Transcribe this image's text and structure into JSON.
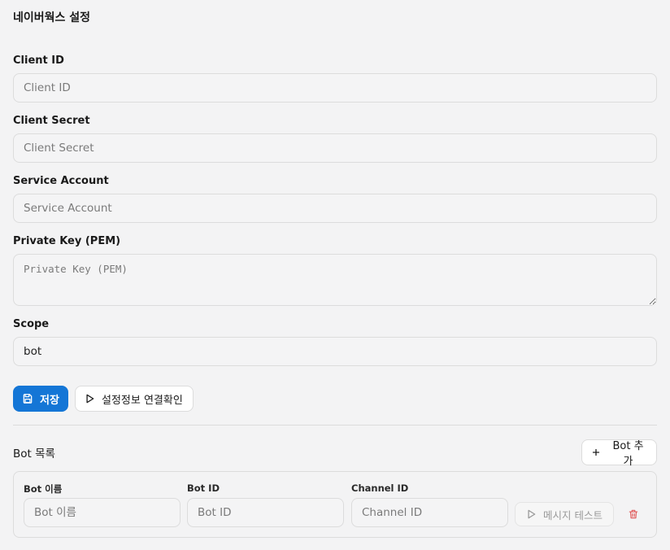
{
  "page": {
    "title": "네이버웍스 설정"
  },
  "form": {
    "client_id": {
      "label": "Client ID",
      "placeholder": "Client ID",
      "value": ""
    },
    "client_secret": {
      "label": "Client Secret",
      "placeholder": "Client Secret",
      "value": ""
    },
    "service_account": {
      "label": "Service Account",
      "placeholder": "Service Account",
      "value": ""
    },
    "private_key": {
      "label": "Private Key (PEM)",
      "placeholder": "Private Key (PEM)",
      "value": ""
    },
    "scope": {
      "label": "Scope",
      "placeholder": "",
      "value": "bot"
    }
  },
  "actions": {
    "save_label": "저장",
    "test_connection_label": "설정정보 연결확인"
  },
  "bots": {
    "section_title": "Bot 목록",
    "add_label": "Bot 추가",
    "columns": {
      "name": "Bot 이름",
      "id": "Bot ID",
      "channel": "Channel ID"
    },
    "rows": [
      {
        "name_placeholder": "Bot 이름",
        "id_placeholder": "Bot ID",
        "channel_placeholder": "Channel ID",
        "test_label": "메시지 테스트"
      }
    ]
  },
  "colors": {
    "primary": "#1476d6",
    "danger": "#e05a5a",
    "background": "#f3f3f4"
  },
  "icons": {
    "save": "floppy-disk-icon",
    "play": "play-icon",
    "plus": "plus-icon",
    "delete": "trash-icon"
  }
}
